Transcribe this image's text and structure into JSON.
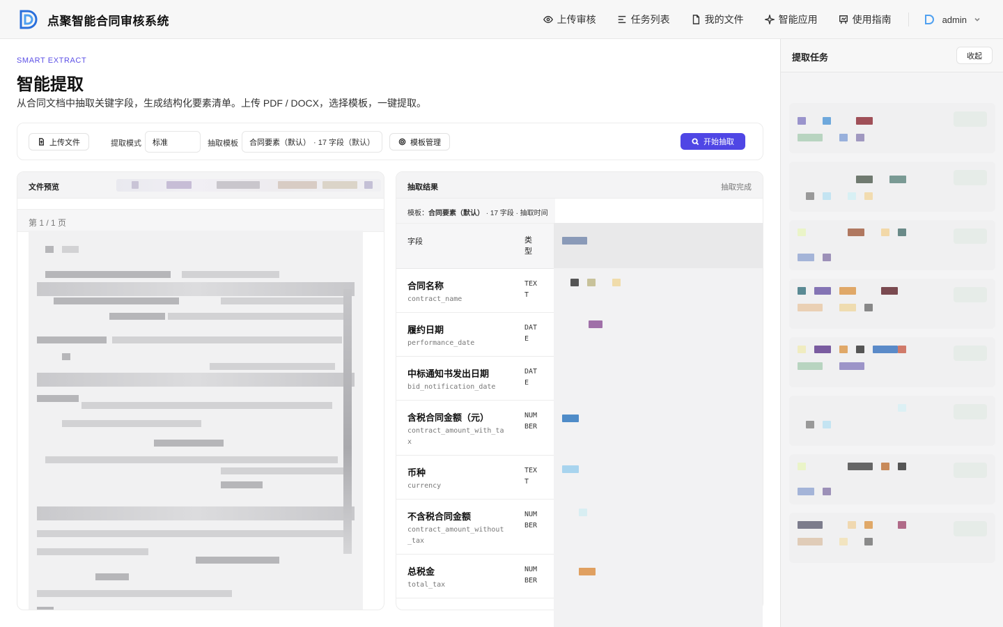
{
  "app": {
    "title": "点聚智能合同审核系统",
    "nav": [
      {
        "label": "上传审核",
        "icon": "eye-icon"
      },
      {
        "label": "任务列表",
        "icon": "list-icon"
      },
      {
        "label": "我的文件",
        "icon": "file-icon"
      },
      {
        "label": "智能应用",
        "icon": "sparkle-icon"
      },
      {
        "label": "使用指南",
        "icon": "guide-icon"
      }
    ],
    "user": "admin"
  },
  "page": {
    "eyebrow": "SMART EXTRACT",
    "title": "智能提取",
    "description": "从合同文档中抽取关键字段，生成结构化要素清单。上传 PDF / DOCX，选择模板，一键提取。"
  },
  "toolbar": {
    "upload_label": "上传文件",
    "mode_label": "提取模式",
    "mode_value": "标准",
    "template_label": "抽取模板",
    "template_value": "合同要素（默认）",
    "template_meta": "· 17 字段（默认）",
    "manage_label": "模板管理",
    "start_label": "开始抽取"
  },
  "preview": {
    "title": "文件预览",
    "page_indicator": "第 1 / 1 页"
  },
  "result": {
    "title": "抽取结果",
    "status": "抽取完成",
    "template_prefix": "模板：",
    "template_name": "合同要素（默认）",
    "template_meta": " · 17 字段 · 抽取时间",
    "columns": {
      "field": "字段",
      "type": "类型"
    },
    "rows": [
      {
        "name": "合同名称",
        "key": "contract_name",
        "type": "TEXT"
      },
      {
        "name": "履约日期",
        "key": "performance_date",
        "type": "DATE"
      },
      {
        "name": "中标通知书发出日期",
        "key": "bid_notification_date",
        "type": "DATE"
      },
      {
        "name": "含税合同金额（元）",
        "key": "contract_amount_with_tax",
        "type": "NUMBER"
      },
      {
        "name": "币种",
        "key": "currency",
        "type": "TEXT"
      },
      {
        "name": "不含税合同金额",
        "key": "contract_amount_without_tax",
        "type": "NUMBER"
      },
      {
        "name": "总税金",
        "key": "total_tax",
        "type": "NUMBER"
      }
    ]
  },
  "side": {
    "title": "提取任务",
    "collapse_label": "收起"
  },
  "colors": {
    "accent": "#4f46e5",
    "eyebrow": "#5b4fe6"
  }
}
